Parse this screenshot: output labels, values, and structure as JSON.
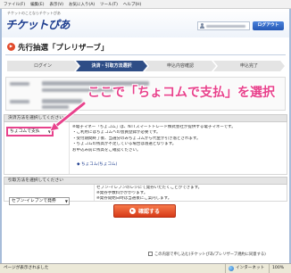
{
  "browser": {
    "menu": [
      "ファイル(F)",
      "編集(E)",
      "表示(V)",
      "お気に入り(A)",
      "ツール(T)",
      "ヘルプ(H)"
    ]
  },
  "header": {
    "tagline": "チケットのことならチケットぴあ",
    "logo": "チケットぴあ",
    "logout_label": "ログアウト"
  },
  "page": {
    "title": "先行抽選「プレリザーブ」"
  },
  "steps": [
    {
      "label": "ログイン",
      "active": false
    },
    {
      "label": "決済・引取方法選択",
      "active": true
    },
    {
      "label": "申込内容確認",
      "active": false
    },
    {
      "label": "申込完了",
      "active": false
    }
  ],
  "annotation": {
    "text": "ここで「ちょコムで支払」を選択"
  },
  "payment": {
    "heading": "決済方法を選択してください",
    "selected": "ちょコムで支払",
    "notes": [
      "※電子マネー「ちょコム」は、NTTスマートトレード株式会社が提供する電子マネーです。",
      "・ご利用にはちょコムへの会員登録が必要です。",
      "・受付期間終了後、当選分のみちょコムから代金が引き落とされます。",
      "・ちょコムの残高が不足している場合は落選となります。",
      "お申込み前に残高をご確認ください。"
    ],
    "link": "◆ ちょコム(ちょコム)"
  },
  "delivery": {
    "heading": "引取方法を選択してください",
    "selected": "セブン-イレブンで発券",
    "notes": [
      "セブン-イレブンのレジにて発券いただくことができます。",
      "※発券手数料がかかります。",
      "※発券開始日時は当選後にご案内します。"
    ]
  },
  "confirm_label": "確認する",
  "agreement": "この内容で申し込む(チケットぴあ/プレリザーブ規約に同意する)",
  "statusbar": {
    "left": "ページが表示されました",
    "zone": "インターネット",
    "zoom": "100%"
  },
  "colors": {
    "accent_pink": "#e8428c",
    "step_active": "#2e4d86",
    "confirm_button": "#d63a18",
    "logout_button": "#2558b4",
    "logo": "#1d3d8f"
  }
}
